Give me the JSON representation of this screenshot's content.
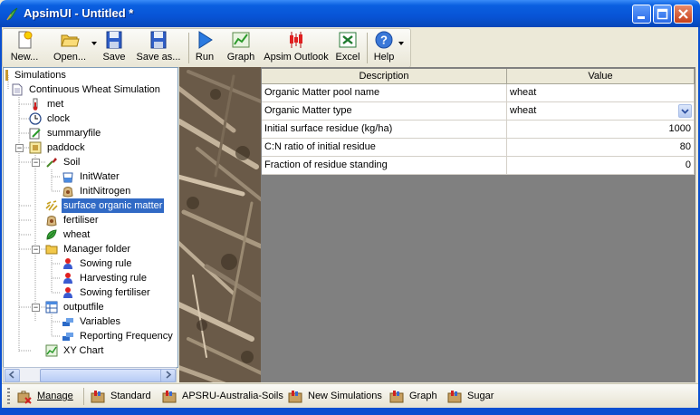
{
  "window": {
    "title": "ApsimUI - Untitled *"
  },
  "toolbar": {
    "buttons": [
      {
        "label": "New..."
      },
      {
        "label": "Open..."
      },
      {
        "label": "Save"
      },
      {
        "label": "Save as..."
      },
      {
        "label": "Run"
      },
      {
        "label": "Graph"
      },
      {
        "label": "Apsim Outlook"
      },
      {
        "label": "Excel"
      },
      {
        "label": "Help"
      }
    ]
  },
  "tree": {
    "nodes": [
      {
        "label": "Simulations",
        "icon": "folder-icon"
      },
      {
        "label": "Continuous Wheat Simulation",
        "icon": "document-icon"
      },
      {
        "label": "met",
        "icon": "thermometer-icon"
      },
      {
        "label": "clock",
        "icon": "clock-icon"
      },
      {
        "label": "summaryfile",
        "icon": "pencil-note-icon"
      },
      {
        "label": "paddock",
        "icon": "paddock-icon"
      },
      {
        "label": "Soil",
        "icon": "shovel-icon"
      },
      {
        "label": "InitWater",
        "icon": "bucket-icon"
      },
      {
        "label": "InitNitrogen",
        "icon": "bag-icon"
      },
      {
        "label": "surface organic matter",
        "icon": "residue-icon",
        "selected": true
      },
      {
        "label": "fertiliser",
        "icon": "bag-icon"
      },
      {
        "label": "wheat",
        "icon": "leaf-icon"
      },
      {
        "label": "Manager folder",
        "icon": "folder-icon"
      },
      {
        "label": "Sowing rule",
        "icon": "person-icon"
      },
      {
        "label": "Harvesting rule",
        "icon": "person-icon"
      },
      {
        "label": "Sowing fertiliser",
        "icon": "person-icon"
      },
      {
        "label": "outputfile",
        "icon": "table-icon"
      },
      {
        "label": "Variables",
        "icon": "variables-icon"
      },
      {
        "label": "Reporting Frequency",
        "icon": "variables-icon"
      },
      {
        "label": "XY Chart",
        "icon": "chart-icon"
      }
    ]
  },
  "grid": {
    "headers": [
      "Description",
      "Value"
    ],
    "rows": [
      {
        "description": "Organic Matter pool name",
        "value": "wheat"
      },
      {
        "description": "Organic Matter type",
        "value": "wheat"
      },
      {
        "description": "Initial surface residue (kg/ha)",
        "value": "1000"
      },
      {
        "description": "C:N ratio of initial residue",
        "value": "80"
      },
      {
        "description": "Fraction of residue standing",
        "value": "0"
      }
    ]
  },
  "bottom_toolbar": {
    "items": [
      {
        "label": "Manage"
      },
      {
        "label": "Standard"
      },
      {
        "label": "APSRU-Australia-Soils"
      },
      {
        "label": "New Simulations"
      },
      {
        "label": "Graph"
      },
      {
        "label": "Sugar"
      }
    ]
  },
  "colors": {
    "titlebar": "#0854d6",
    "selection": "#316ac5"
  }
}
